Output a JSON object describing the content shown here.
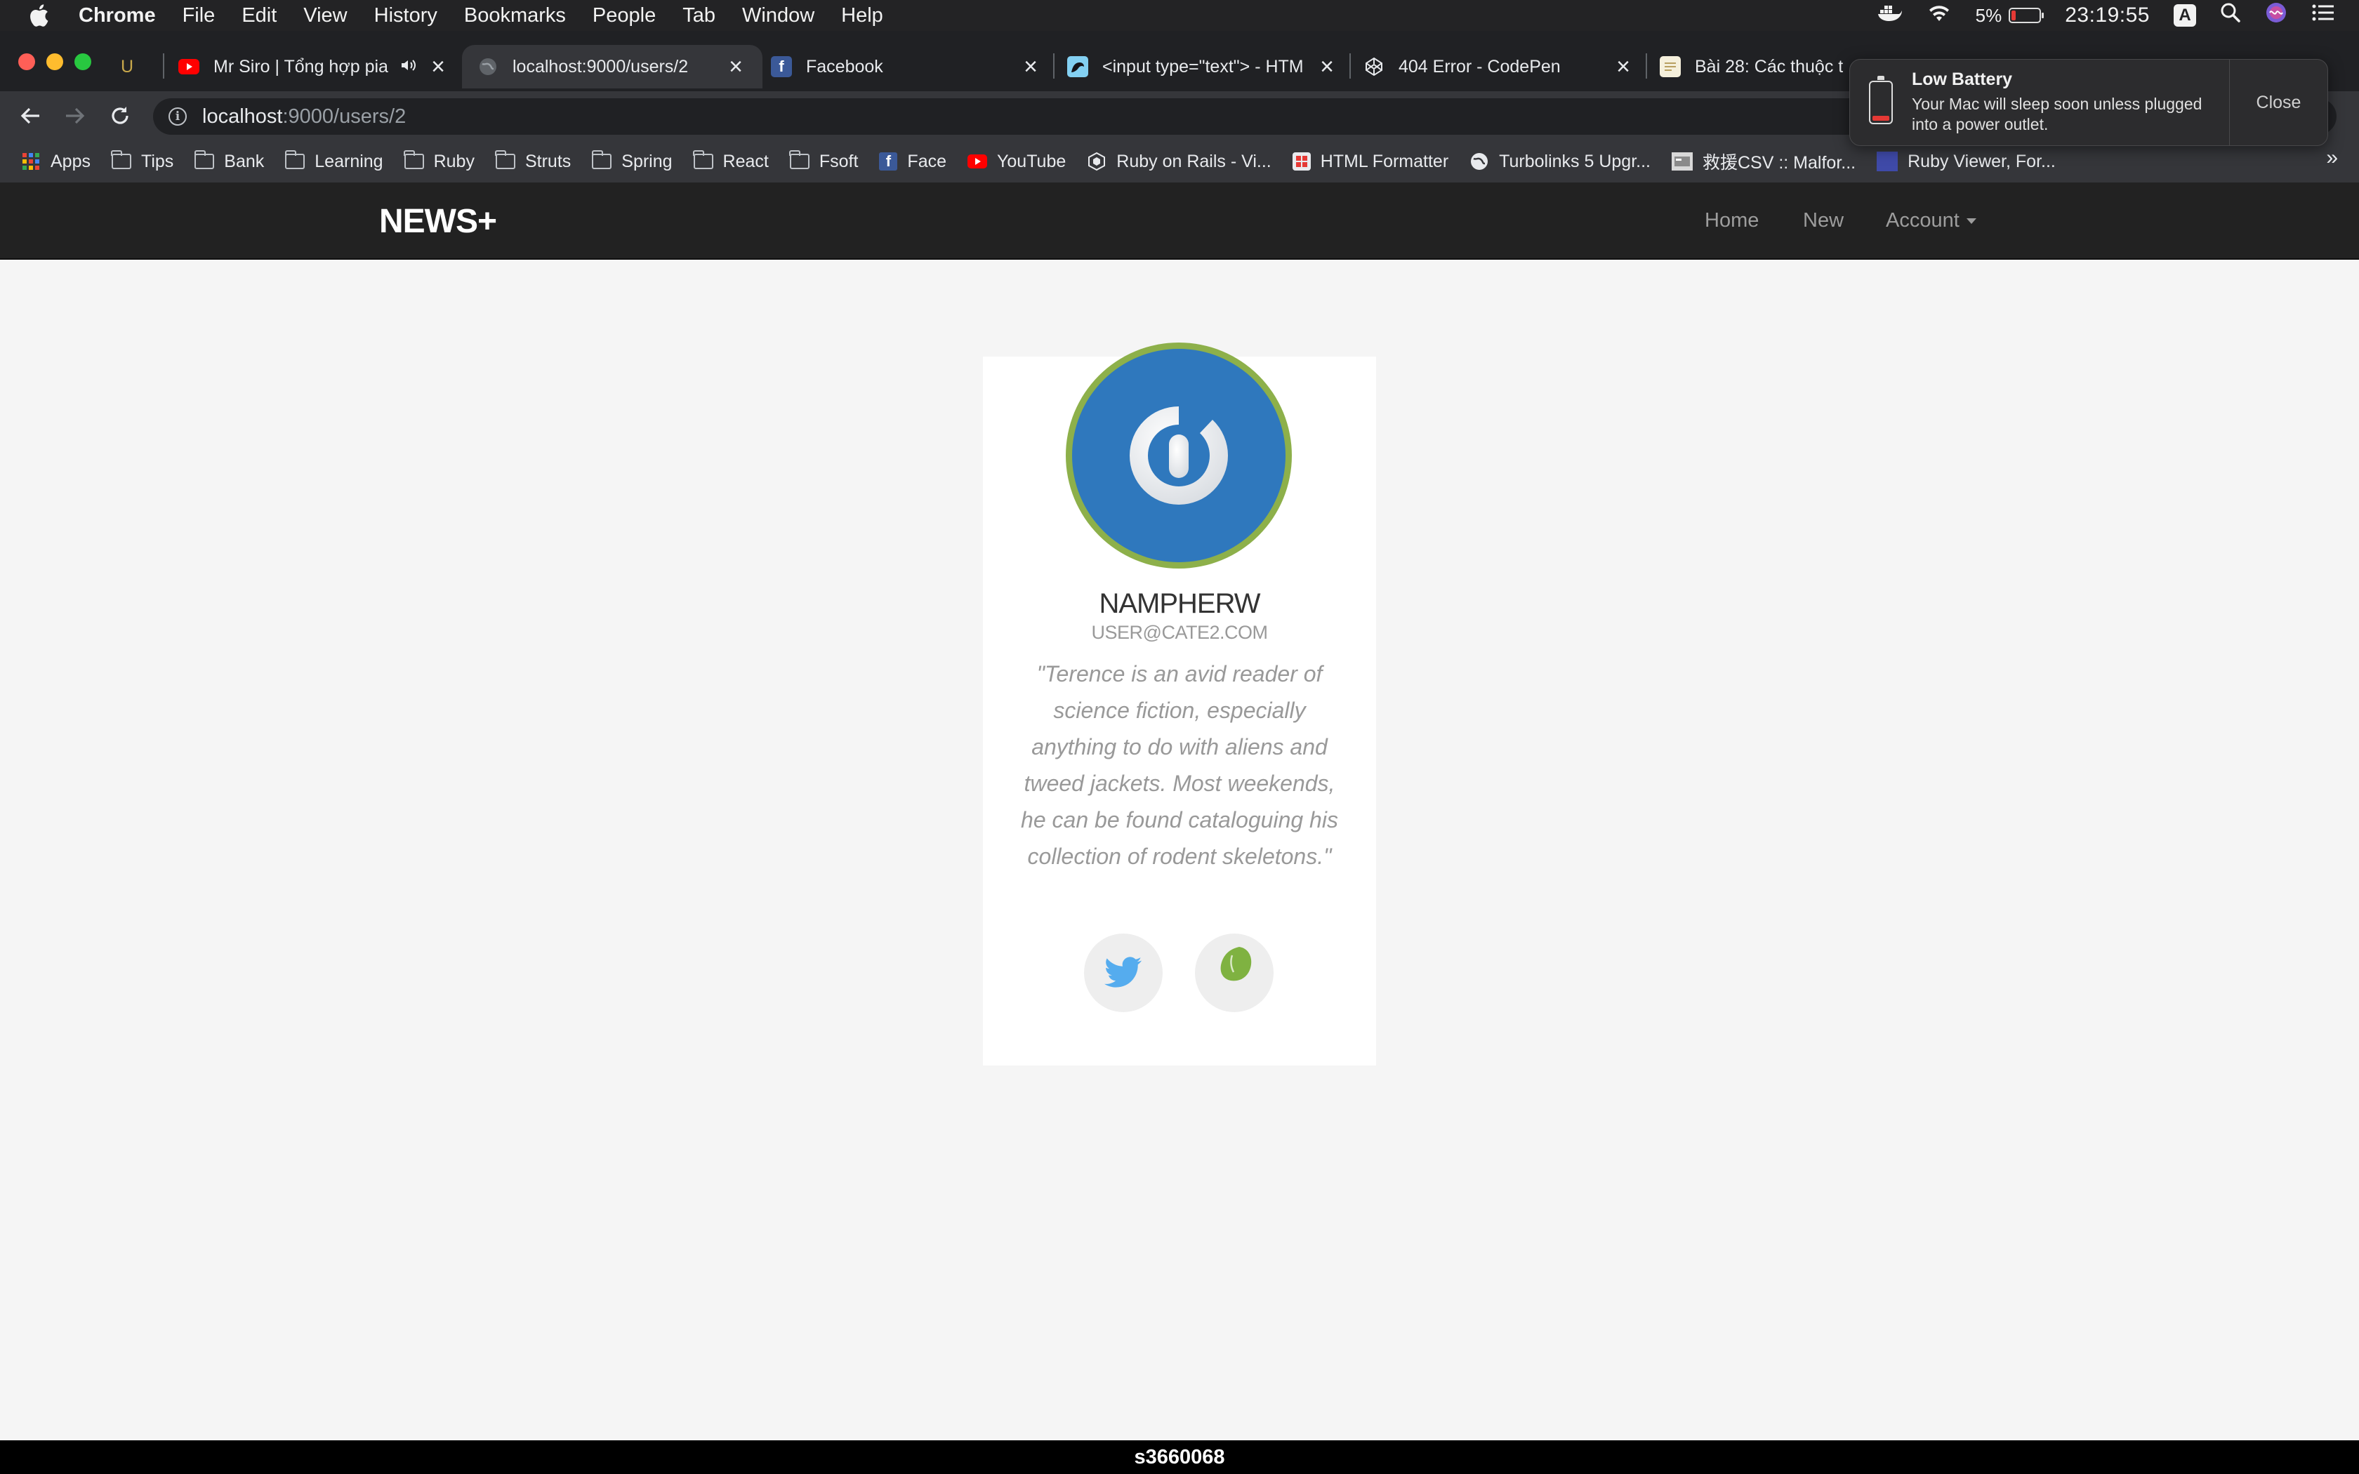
{
  "menubar": {
    "app_name": "Chrome",
    "items": [
      "File",
      "Edit",
      "View",
      "History",
      "Bookmarks",
      "People",
      "Tab",
      "Window",
      "Help"
    ],
    "battery_percent": "5%",
    "clock": "23:19:55",
    "input_source": "A"
  },
  "tabs": [
    {
      "title": "U",
      "icon": "underline-favicon"
    },
    {
      "title": "Mr Siro | Tổng hợp pia",
      "icon": "youtube-icon",
      "audio": true
    },
    {
      "title": "localhost:9000/users/2",
      "icon": "globe-icon",
      "active": true
    },
    {
      "title": "Facebook",
      "icon": "facebook-icon"
    },
    {
      "title": "<input type=\"text\"> - HTM",
      "icon": "mdn-icon"
    },
    {
      "title": "404 Error - CodePen",
      "icon": "codepen-icon"
    },
    {
      "title": "Bài 28: Các thuộc t",
      "icon": "document-icon"
    }
  ],
  "address_bar": {
    "host": "localhost",
    "path": ":9000/users/2"
  },
  "bookmarks": [
    {
      "label": "Apps",
      "icon": "apps-grid-icon"
    },
    {
      "label": "Tips",
      "icon": "folder-icon"
    },
    {
      "label": "Bank",
      "icon": "folder-icon"
    },
    {
      "label": "Learning",
      "icon": "folder-icon"
    },
    {
      "label": "Ruby",
      "icon": "folder-icon"
    },
    {
      "label": "Struts",
      "icon": "folder-icon"
    },
    {
      "label": "Spring",
      "icon": "folder-icon"
    },
    {
      "label": "React",
      "icon": "folder-icon"
    },
    {
      "label": "Fsoft",
      "icon": "folder-icon"
    },
    {
      "label": "Face",
      "icon": "facebook-icon"
    },
    {
      "label": "YouTube",
      "icon": "youtube-icon"
    },
    {
      "label": "Ruby on Rails - Vi...",
      "icon": "rails-icon"
    },
    {
      "label": "HTML Formatter",
      "icon": "formatter-icon"
    },
    {
      "label": "Turbolinks 5 Upgr...",
      "icon": "globe-icon"
    },
    {
      "label": "救援CSV :: Malfor...",
      "icon": "csv-icon"
    },
    {
      "label": "Ruby Viewer, For...",
      "icon": "code-beautify-icon"
    }
  ],
  "bookmarks_more": "»",
  "notification": {
    "title": "Low Battery",
    "text": "Your Mac will sleep soon unless plugged into a power outlet.",
    "close_label": "Close"
  },
  "site": {
    "brand": "NEWS+",
    "nav": {
      "home": "Home",
      "new": "New",
      "account": "Account"
    }
  },
  "profile": {
    "username": "NAMPHERW",
    "email": "USER@CATE2.COM",
    "bio": "\"Terence is an avid reader of science fiction, especially anything to do with aliens and tweed jackets. Most weekends, he can be found cataloguing his collection of rodent skeletons.\"",
    "social": [
      "twitter-icon",
      "evernote-icon"
    ]
  },
  "footer_label": "s3660068",
  "colors": {
    "navbar": "#222222",
    "page_bg": "#f5f5f5",
    "avatar_ring": "#8db04a",
    "avatar_fill": "#2f78bd",
    "twitter": "#55acee",
    "evernote": "#7fb241"
  }
}
